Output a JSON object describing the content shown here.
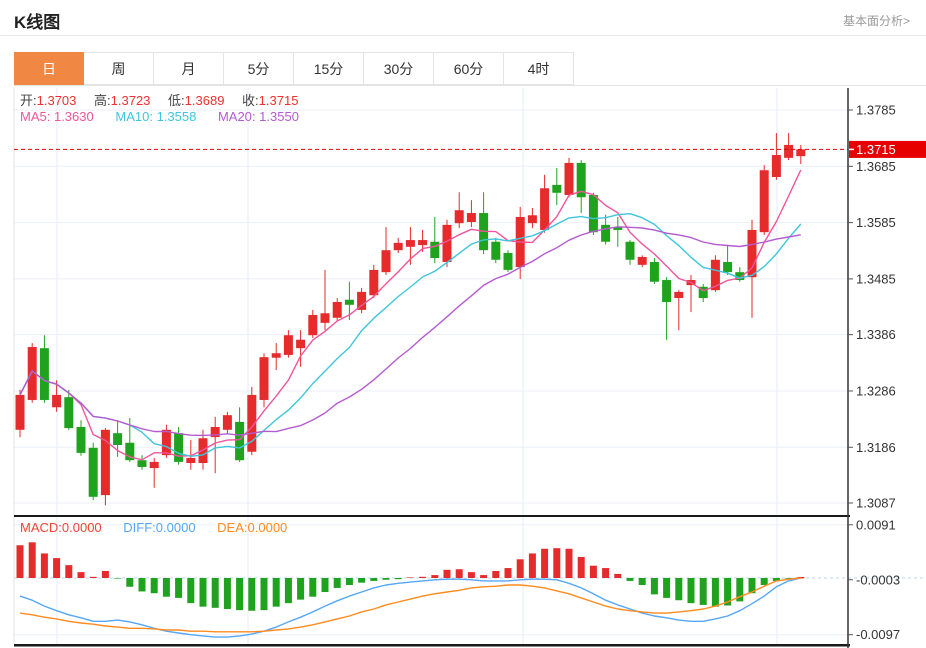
{
  "header": {
    "title": "K线图",
    "link": "基本面分析>"
  },
  "tabs": {
    "items": [
      "日",
      "周",
      "月",
      "5分",
      "15分",
      "30分",
      "60分",
      "4时"
    ],
    "active_index": 0
  },
  "overlay": {
    "ohlc": [
      {
        "label": "开:",
        "value": "1.3703"
      },
      {
        "label": "高:",
        "value": "1.3723"
      },
      {
        "label": "低:",
        "value": "1.3689"
      },
      {
        "label": "收:",
        "value": "1.3715"
      }
    ],
    "ma": [
      {
        "label": "MA5:",
        "value": "1.3630"
      },
      {
        "label": "MA10:",
        "value": "1.3558"
      },
      {
        "label": "MA20:",
        "value": "1.3550"
      }
    ],
    "macd": [
      {
        "label": "MACD:",
        "value": "0.0000"
      },
      {
        "label": "DIFF:",
        "value": "0.0000"
      },
      {
        "label": "DEA:",
        "value": "0.0000"
      }
    ]
  },
  "price_axis": {
    "labels": [
      "1.3785",
      "1.3685",
      "1.3585",
      "1.3485",
      "1.3386",
      "1.3286",
      "1.3186",
      "1.3087"
    ],
    "current_badge": "1.3715",
    "current_value": 1.3715
  },
  "macd_axis": {
    "labels": [
      "0.0091",
      "-0.0003",
      "-0.0097"
    ]
  },
  "colors": {
    "tab_active": "#f08742",
    "up": "#e52b2b",
    "down": "#1fa31f",
    "badge": "#e60000",
    "price_line": "#e60000",
    "ma5": "#f0559b",
    "ma10": "#3fc5dc",
    "ma20": "#b55bd0",
    "diff": "#55a7f7",
    "dea": "#ff8b1f",
    "grid": "#eceff5",
    "vgrid": "#e4ecf5",
    "axis_text": "#333333",
    "axis_line": "#333333",
    "zero_dash": "#b5d9f2",
    "panel_border": "#1a1a1a"
  },
  "chart_data": {
    "type": "candlestick+macd",
    "title": "K线图 (daily K-line with MA5/MA10/MA20 and MACD)",
    "main": {
      "ylim": [
        1.3087,
        1.3785
      ],
      "grid_prices": [
        1.3785,
        1.3685,
        1.3585,
        1.3485,
        1.3386,
        1.3286,
        1.3186,
        1.3087
      ],
      "current_price_line": 1.3715,
      "ma_periods": [
        5,
        10,
        20
      ],
      "ohlc": [
        [
          1.3217,
          1.3288,
          1.3204,
          1.3279
        ],
        [
          1.327,
          1.3371,
          1.3265,
          1.3364
        ],
        [
          1.3362,
          1.3385,
          1.3265,
          1.327
        ],
        [
          1.3257,
          1.3305,
          1.3249,
          1.3279
        ],
        [
          1.3275,
          1.3288,
          1.3217,
          1.322
        ],
        [
          1.3222,
          1.3234,
          1.3171,
          1.3176
        ],
        [
          1.3185,
          1.3194,
          1.3092,
          1.3098
        ],
        [
          1.3101,
          1.322,
          1.3083,
          1.3217
        ],
        [
          1.3211,
          1.3234,
          1.3169,
          1.319
        ],
        [
          1.3194,
          1.3238,
          1.316,
          1.3163
        ],
        [
          1.3163,
          1.3172,
          1.3146,
          1.3151
        ],
        [
          1.3149,
          1.3167,
          1.3114,
          1.316
        ],
        [
          1.3172,
          1.3226,
          1.3167,
          1.3217
        ],
        [
          1.3211,
          1.3222,
          1.3155,
          1.316
        ],
        [
          1.3158,
          1.3199,
          1.3146,
          1.3167
        ],
        [
          1.3158,
          1.3217,
          1.3146,
          1.3202
        ],
        [
          1.3204,
          1.324,
          1.314,
          1.3222
        ],
        [
          1.3217,
          1.3249,
          1.3211,
          1.3243
        ],
        [
          1.3231,
          1.3257,
          1.316,
          1.3163
        ],
        [
          1.3178,
          1.3293,
          1.3172,
          1.3279
        ],
        [
          1.327,
          1.3353,
          1.3257,
          1.3346
        ],
        [
          1.3345,
          1.3371,
          1.3323,
          1.3353
        ],
        [
          1.335,
          1.3394,
          1.3345,
          1.3385
        ],
        [
          1.3362,
          1.3394,
          1.3329,
          1.3377
        ],
        [
          1.3385,
          1.343,
          1.338,
          1.3421
        ],
        [
          1.3407,
          1.3501,
          1.3394,
          1.3424
        ],
        [
          1.3416,
          1.3451,
          1.341,
          1.3444
        ],
        [
          1.3448,
          1.348,
          1.3412,
          1.3439
        ],
        [
          1.343,
          1.3469,
          1.3424,
          1.3462
        ],
        [
          1.3456,
          1.351,
          1.3451,
          1.3501
        ],
        [
          1.3497,
          1.3577,
          1.3492,
          1.3536
        ],
        [
          1.3536,
          1.3558,
          1.3531,
          1.3549
        ],
        [
          1.3542,
          1.3577,
          1.351,
          1.3554
        ],
        [
          1.3545,
          1.3572,
          1.3533,
          1.3554
        ],
        [
          1.3551,
          1.3595,
          1.3513,
          1.3522
        ],
        [
          1.3515,
          1.359,
          1.3506,
          1.3581
        ],
        [
          1.3584,
          1.3639,
          1.3575,
          1.3607
        ],
        [
          1.3586,
          1.3625,
          1.3577,
          1.3602
        ],
        [
          1.3602,
          1.3639,
          1.3529,
          1.3536
        ],
        [
          1.3551,
          1.3558,
          1.3513,
          1.3519
        ],
        [
          1.3531,
          1.3536,
          1.3497,
          1.3501
        ],
        [
          1.3506,
          1.3613,
          1.3485,
          1.3595
        ],
        [
          1.3584,
          1.3611,
          1.3575,
          1.3598
        ],
        [
          1.3572,
          1.367,
          1.3567,
          1.3646
        ],
        [
          1.3652,
          1.3682,
          1.3616,
          1.3638
        ],
        [
          1.3634,
          1.37,
          1.363,
          1.3691
        ],
        [
          1.3691,
          1.3696,
          1.3602,
          1.363
        ],
        [
          1.3634,
          1.3638,
          1.3563,
          1.3568
        ],
        [
          1.3581,
          1.3599,
          1.3546,
          1.3551
        ],
        [
          1.3577,
          1.3595,
          1.3542,
          1.3572
        ],
        [
          1.3551,
          1.3554,
          1.351,
          1.3519
        ],
        [
          1.351,
          1.3527,
          1.3506,
          1.3524
        ],
        [
          1.3515,
          1.3522,
          1.3476,
          1.348
        ],
        [
          1.3483,
          1.3488,
          1.3377,
          1.3444
        ],
        [
          1.3451,
          1.3465,
          1.3394,
          1.3462
        ],
        [
          1.3474,
          1.3492,
          1.3426,
          1.3483
        ],
        [
          1.3471,
          1.3476,
          1.3444,
          1.3451
        ],
        [
          1.3465,
          1.3527,
          1.3462,
          1.3519
        ],
        [
          1.3515,
          1.3545,
          1.3492,
          1.3497
        ],
        [
          1.3497,
          1.3506,
          1.348,
          1.3483
        ],
        [
          1.3488,
          1.359,
          1.3416,
          1.3572
        ],
        [
          1.3568,
          1.3687,
          1.3563,
          1.3678
        ],
        [
          1.3666,
          1.3744,
          1.3661,
          1.3705
        ],
        [
          1.37,
          1.3744,
          1.3696,
          1.3723
        ],
        [
          1.3703,
          1.3723,
          1.3689,
          1.3715
        ]
      ]
    },
    "macd": {
      "ylim": [
        -0.0097,
        0.0091
      ],
      "grid_values": [
        0.0091,
        -0.0097
      ],
      "hist": [
        0.0056,
        0.0061,
        0.0042,
        0.0034,
        0.0022,
        0.001,
        0.0002,
        0.0012,
        -0.0001,
        -0.0015,
        -0.0023,
        -0.0026,
        -0.0032,
        -0.0034,
        -0.0043,
        -0.0049,
        -0.0051,
        -0.0053,
        -0.0055,
        -0.0056,
        -0.0055,
        -0.0049,
        -0.0043,
        -0.0037,
        -0.0032,
        -0.0024,
        -0.0017,
        -0.0012,
        -0.0008,
        -0.0005,
        -0.0003,
        -0.0002,
        0.0001,
        0.0002,
        0.0005,
        0.0014,
        0.0015,
        0.001,
        0.0005,
        0.0012,
        0.0017,
        0.0032,
        0.0042,
        0.005,
        0.0051,
        0.005,
        0.0036,
        0.0021,
        0.0017,
        0.0007,
        -0.0005,
        -0.0012,
        -0.0028,
        -0.0034,
        -0.0038,
        -0.0043,
        -0.0046,
        -0.0049,
        -0.0047,
        -0.004,
        -0.0026,
        -0.0012,
        -0.0005,
        -0.0001,
        0.0
      ],
      "diff": [
        -0.0031,
        -0.0038,
        -0.0048,
        -0.0056,
        -0.0063,
        -0.0068,
        -0.0074,
        -0.0074,
        -0.0072,
        -0.0075,
        -0.008,
        -0.0086,
        -0.0091,
        -0.0094,
        -0.0097,
        -0.0099,
        -0.0101,
        -0.0101,
        -0.0099,
        -0.0096,
        -0.0091,
        -0.0084,
        -0.0075,
        -0.0067,
        -0.0058,
        -0.0048,
        -0.0039,
        -0.0031,
        -0.0024,
        -0.0017,
        -0.0012,
        -0.0009,
        -0.0007,
        -0.0005,
        -0.0003,
        -0.0002,
        -0.0002,
        -0.0003,
        -0.0005,
        -0.0005,
        -0.0005,
        -0.0003,
        -0.0002,
        -0.0002,
        -0.0003,
        -0.0009,
        -0.0017,
        -0.0027,
        -0.0038,
        -0.0046,
        -0.0053,
        -0.006,
        -0.0065,
        -0.0068,
        -0.0072,
        -0.0074,
        -0.0074,
        -0.007,
        -0.0065,
        -0.0056,
        -0.0044,
        -0.0031,
        -0.0015,
        -0.0005,
        0.0
      ],
      "dea": [
        -0.006,
        -0.0063,
        -0.0067,
        -0.007,
        -0.0074,
        -0.0077,
        -0.0079,
        -0.0082,
        -0.0084,
        -0.0086,
        -0.0086,
        -0.0087,
        -0.0089,
        -0.0089,
        -0.0091,
        -0.0091,
        -0.0092,
        -0.0092,
        -0.0092,
        -0.0092,
        -0.0091,
        -0.0089,
        -0.0087,
        -0.0084,
        -0.008,
        -0.0075,
        -0.007,
        -0.0065,
        -0.0058,
        -0.0053,
        -0.0046,
        -0.0041,
        -0.0036,
        -0.0031,
        -0.0027,
        -0.0024,
        -0.0021,
        -0.0017,
        -0.0015,
        -0.0014,
        -0.0012,
        -0.0012,
        -0.0014,
        -0.0017,
        -0.0022,
        -0.0027,
        -0.0034,
        -0.0041,
        -0.0048,
        -0.0053,
        -0.0056,
        -0.0058,
        -0.006,
        -0.006,
        -0.0058,
        -0.0056,
        -0.0053,
        -0.0048,
        -0.0041,
        -0.0032,
        -0.0024,
        -0.0014,
        -0.0005,
        -0.0002,
        0.0
      ]
    }
  }
}
